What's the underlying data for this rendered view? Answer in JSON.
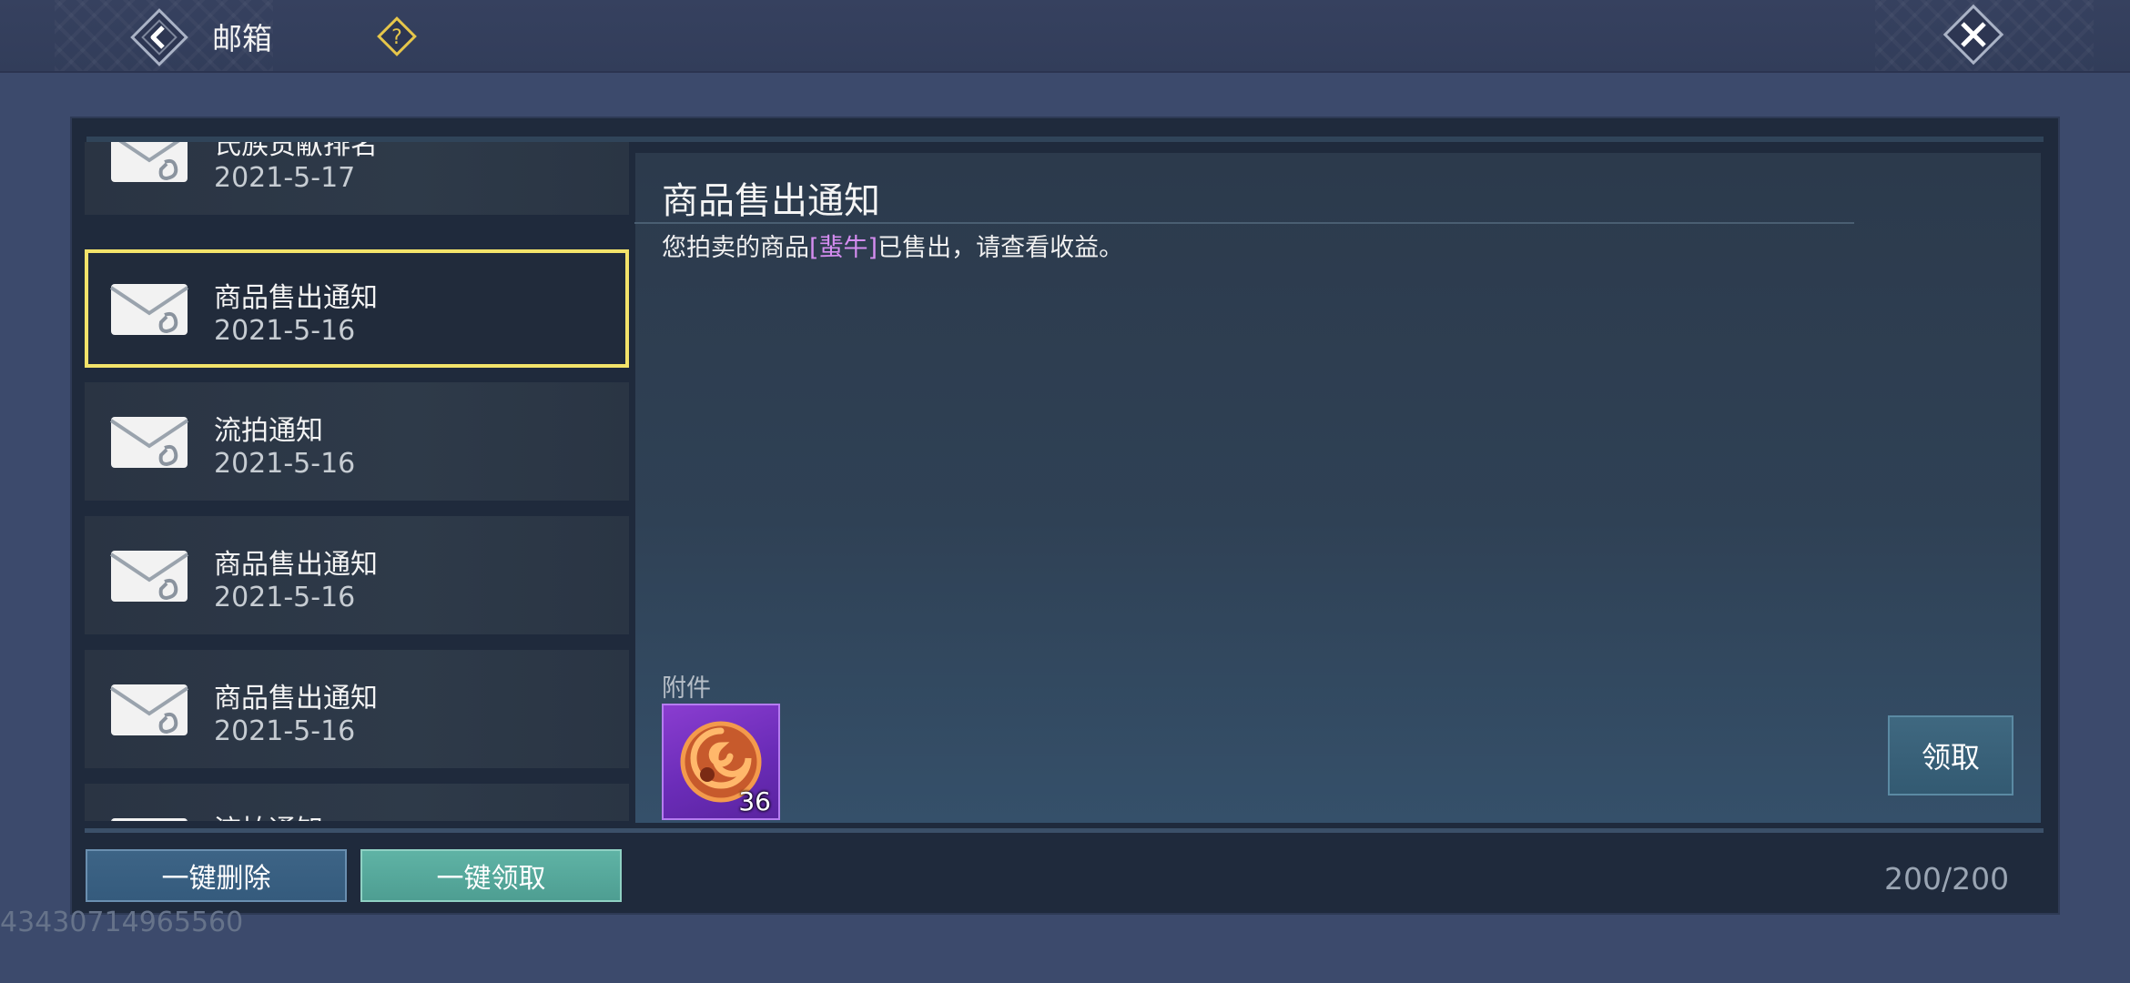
{
  "header": {
    "title": "邮箱",
    "back_icon": "back-arrow-icon",
    "help_icon": "question-mark-icon",
    "close_icon": "close-x-icon"
  },
  "mail_list": {
    "items": [
      {
        "subject": "氏族贡献排名",
        "date": "2021-5-17",
        "icon": "envelope-attachment-icon",
        "selected": false
      },
      {
        "subject": "商品售出通知",
        "date": "2021-5-16",
        "icon": "envelope-attachment-icon",
        "selected": true
      },
      {
        "subject": "流拍通知",
        "date": "2021-5-16",
        "icon": "envelope-attachment-icon",
        "selected": false
      },
      {
        "subject": "商品售出通知",
        "date": "2021-5-16",
        "icon": "envelope-attachment-icon",
        "selected": false
      },
      {
        "subject": "商品售出通知",
        "date": "2021-5-16",
        "icon": "envelope-attachment-icon",
        "selected": false
      },
      {
        "subject": "流拍通知",
        "date": "",
        "icon": "envelope-attachment-icon",
        "selected": false
      }
    ]
  },
  "detail": {
    "title": "商品售出通知",
    "body_prefix": "您拍卖的商品",
    "item_name": "[蜚牛]",
    "body_suffix": "已售出，请查看收益。",
    "attachment_label": "附件",
    "attachment": {
      "icon": "swirl-currency-icon",
      "quantity": "36"
    },
    "claim_label": "领取"
  },
  "footer": {
    "delete_all_label": "一键删除",
    "claim_all_label": "一键领取",
    "mail_count": "200/200",
    "uid": "43430714965560"
  },
  "colors": {
    "selected_border": "#f3e36a",
    "item_name": "#d58df0",
    "claim_all_button": "#5fb3a5",
    "delete_all_button": "#3d6486"
  }
}
